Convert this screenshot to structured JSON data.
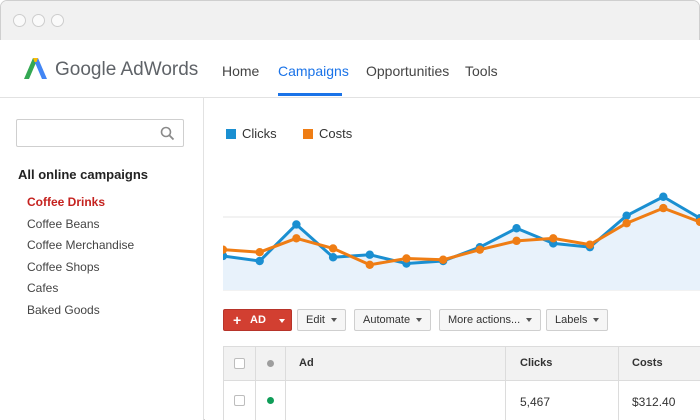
{
  "app": {
    "logo_text": "Google AdWords",
    "brand_colors": {
      "blue": "#4285f4",
      "green": "#34a853",
      "yellow": "#fbbc05"
    }
  },
  "nav": {
    "items": [
      {
        "label": "Home",
        "active": false
      },
      {
        "label": "Campaigns",
        "active": true
      },
      {
        "label": "Opportunities",
        "active": false
      },
      {
        "label": "Tools",
        "active": false
      }
    ],
    "active_color": "#1a73e8"
  },
  "sidebar": {
    "search": {
      "value": "",
      "placeholder": ""
    },
    "heading": "All online campaigns",
    "items": [
      {
        "label": "Coffee Drinks",
        "active": true
      },
      {
        "label": "Coffee Beans",
        "active": false
      },
      {
        "label": "Coffee Merchandise",
        "active": false
      },
      {
        "label": "Coffee Shops",
        "active": false
      },
      {
        "label": "Cafes",
        "active": false
      },
      {
        "label": "Baked Goods",
        "active": false
      }
    ],
    "active_color": "#c5221f"
  },
  "chart_data": {
    "type": "line",
    "title": "",
    "xlabel": "",
    "ylabel": "",
    "x": [
      1,
      2,
      3,
      4,
      5,
      6,
      7,
      8,
      9,
      10,
      11,
      12,
      13,
      14
    ],
    "ylim": [
      0,
      100
    ],
    "grid": true,
    "legend_placement": "top-left",
    "series": [
      {
        "name": "Clicks",
        "color": "#1a8fd1",
        "fill": "#e8f2fb",
        "values": [
          27,
          23,
          52,
          26,
          28,
          21,
          23,
          34,
          49,
          37,
          34,
          59,
          74,
          57
        ]
      },
      {
        "name": "Costs",
        "color": "#ef7d14",
        "values": [
          32,
          30,
          41,
          33,
          20,
          25,
          24,
          32,
          39,
          41,
          36,
          53,
          65,
          54
        ]
      }
    ]
  },
  "toolbar": {
    "ad_button": {
      "label": "AD",
      "color": "#d23f31"
    },
    "buttons": [
      "Edit",
      "Automate",
      "More actions...",
      "Labels"
    ]
  },
  "table": {
    "columns": [
      "Ad",
      "Clicks",
      "Costs"
    ],
    "rows": [
      {
        "status_color": "#0f9d58",
        "ad": "",
        "clicks": "5,467",
        "costs": "$312.40"
      }
    ],
    "header_status_color": "#9e9e9e"
  }
}
